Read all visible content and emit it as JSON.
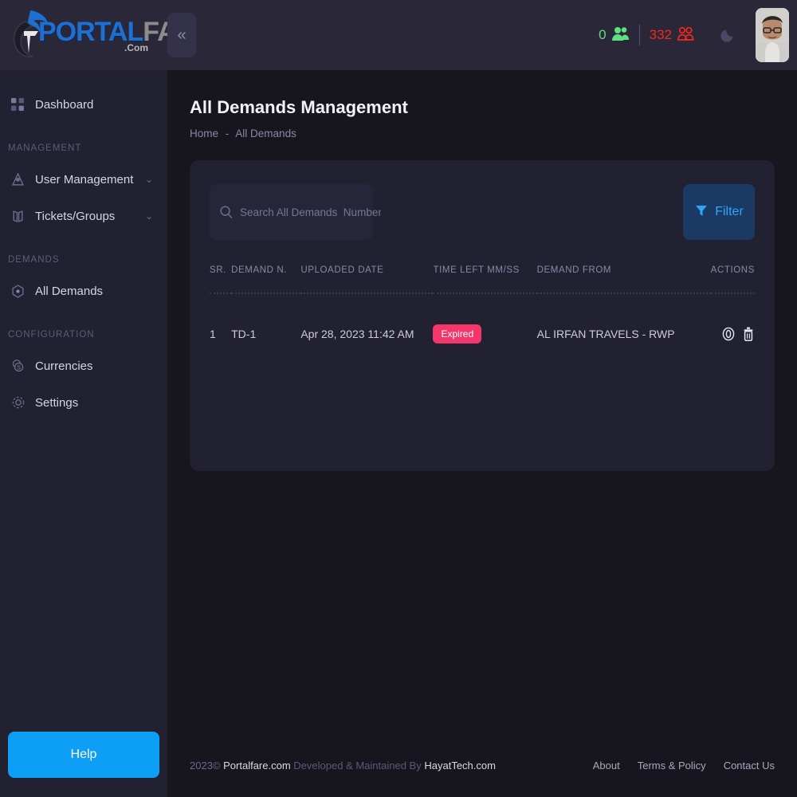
{
  "brand": {
    "logo_portal": "PORTAL",
    "logo_fare": "FARE",
    "logo_com": ".Com"
  },
  "topbar": {
    "collapse_label": "«",
    "online_count": "0",
    "total_count": "332",
    "theme_toggle_name": "moon",
    "avatar_alt": "User avatar"
  },
  "sidebar": {
    "items": [
      {
        "label": "Dashboard",
        "icon": "grid-icon",
        "chevron": ""
      },
      {
        "label": "MANAGEMENT",
        "type": "section"
      },
      {
        "label": "User Management",
        "icon": "user-icon",
        "chevron": "⌄"
      },
      {
        "label": "Tickets/Groups",
        "icon": "ticket-icon",
        "chevron": "⌄"
      },
      {
        "label": "DEMANDS",
        "type": "section"
      },
      {
        "label": "All Demands",
        "icon": "hexagon-icon",
        "chevron": ""
      },
      {
        "label": "CONFIGURATION",
        "type": "section"
      },
      {
        "label": "Currencies",
        "icon": "coins-icon",
        "chevron": ""
      },
      {
        "label": "Settings",
        "icon": "gear-icon",
        "chevron": ""
      }
    ],
    "help_label": "Help"
  },
  "page": {
    "title": "All Demands Management",
    "breadcrumb_home": "Home",
    "breadcrumb_sep": "-",
    "breadcrumb_current": "All Demands"
  },
  "toolbar": {
    "search_value": "",
    "search_placeholder": "Search All Demands  Number",
    "filter_label": "Filter"
  },
  "table": {
    "headers": [
      "SR.",
      "DEMAND N.",
      "UPLOADED DATE",
      "TIME LEFT MM/SS",
      "DEMAND FROM",
      "ACTIONS"
    ],
    "rows": [
      {
        "sr": "1",
        "demand_no": "TD-1",
        "uploaded_date": "Apr 28, 2023 11:42 AM",
        "time_left": "Expired",
        "demand_from": "AL IRFAN TRAVELS - RWP",
        "actions": [
          "view-icon",
          "delete-icon"
        ]
      }
    ]
  },
  "footer": {
    "year": "2023©",
    "site": "Portalfare.com",
    "maintained_by_text": "Developed & Maintained By",
    "developer": "HayatTech.com",
    "links": [
      "About",
      "Terms & Policy",
      "Contact Us"
    ]
  },
  "colors": {
    "accent_blue": "#0d9ef5",
    "filter_blue": "#2ea6fb",
    "badge_expired": "#f5366a",
    "online_green": "#5fe07e",
    "total_red": "#f5271f",
    "sidebar_bg": "#222131",
    "page_bg": "#17161f",
    "topbar_bg": "#2a2838"
  }
}
